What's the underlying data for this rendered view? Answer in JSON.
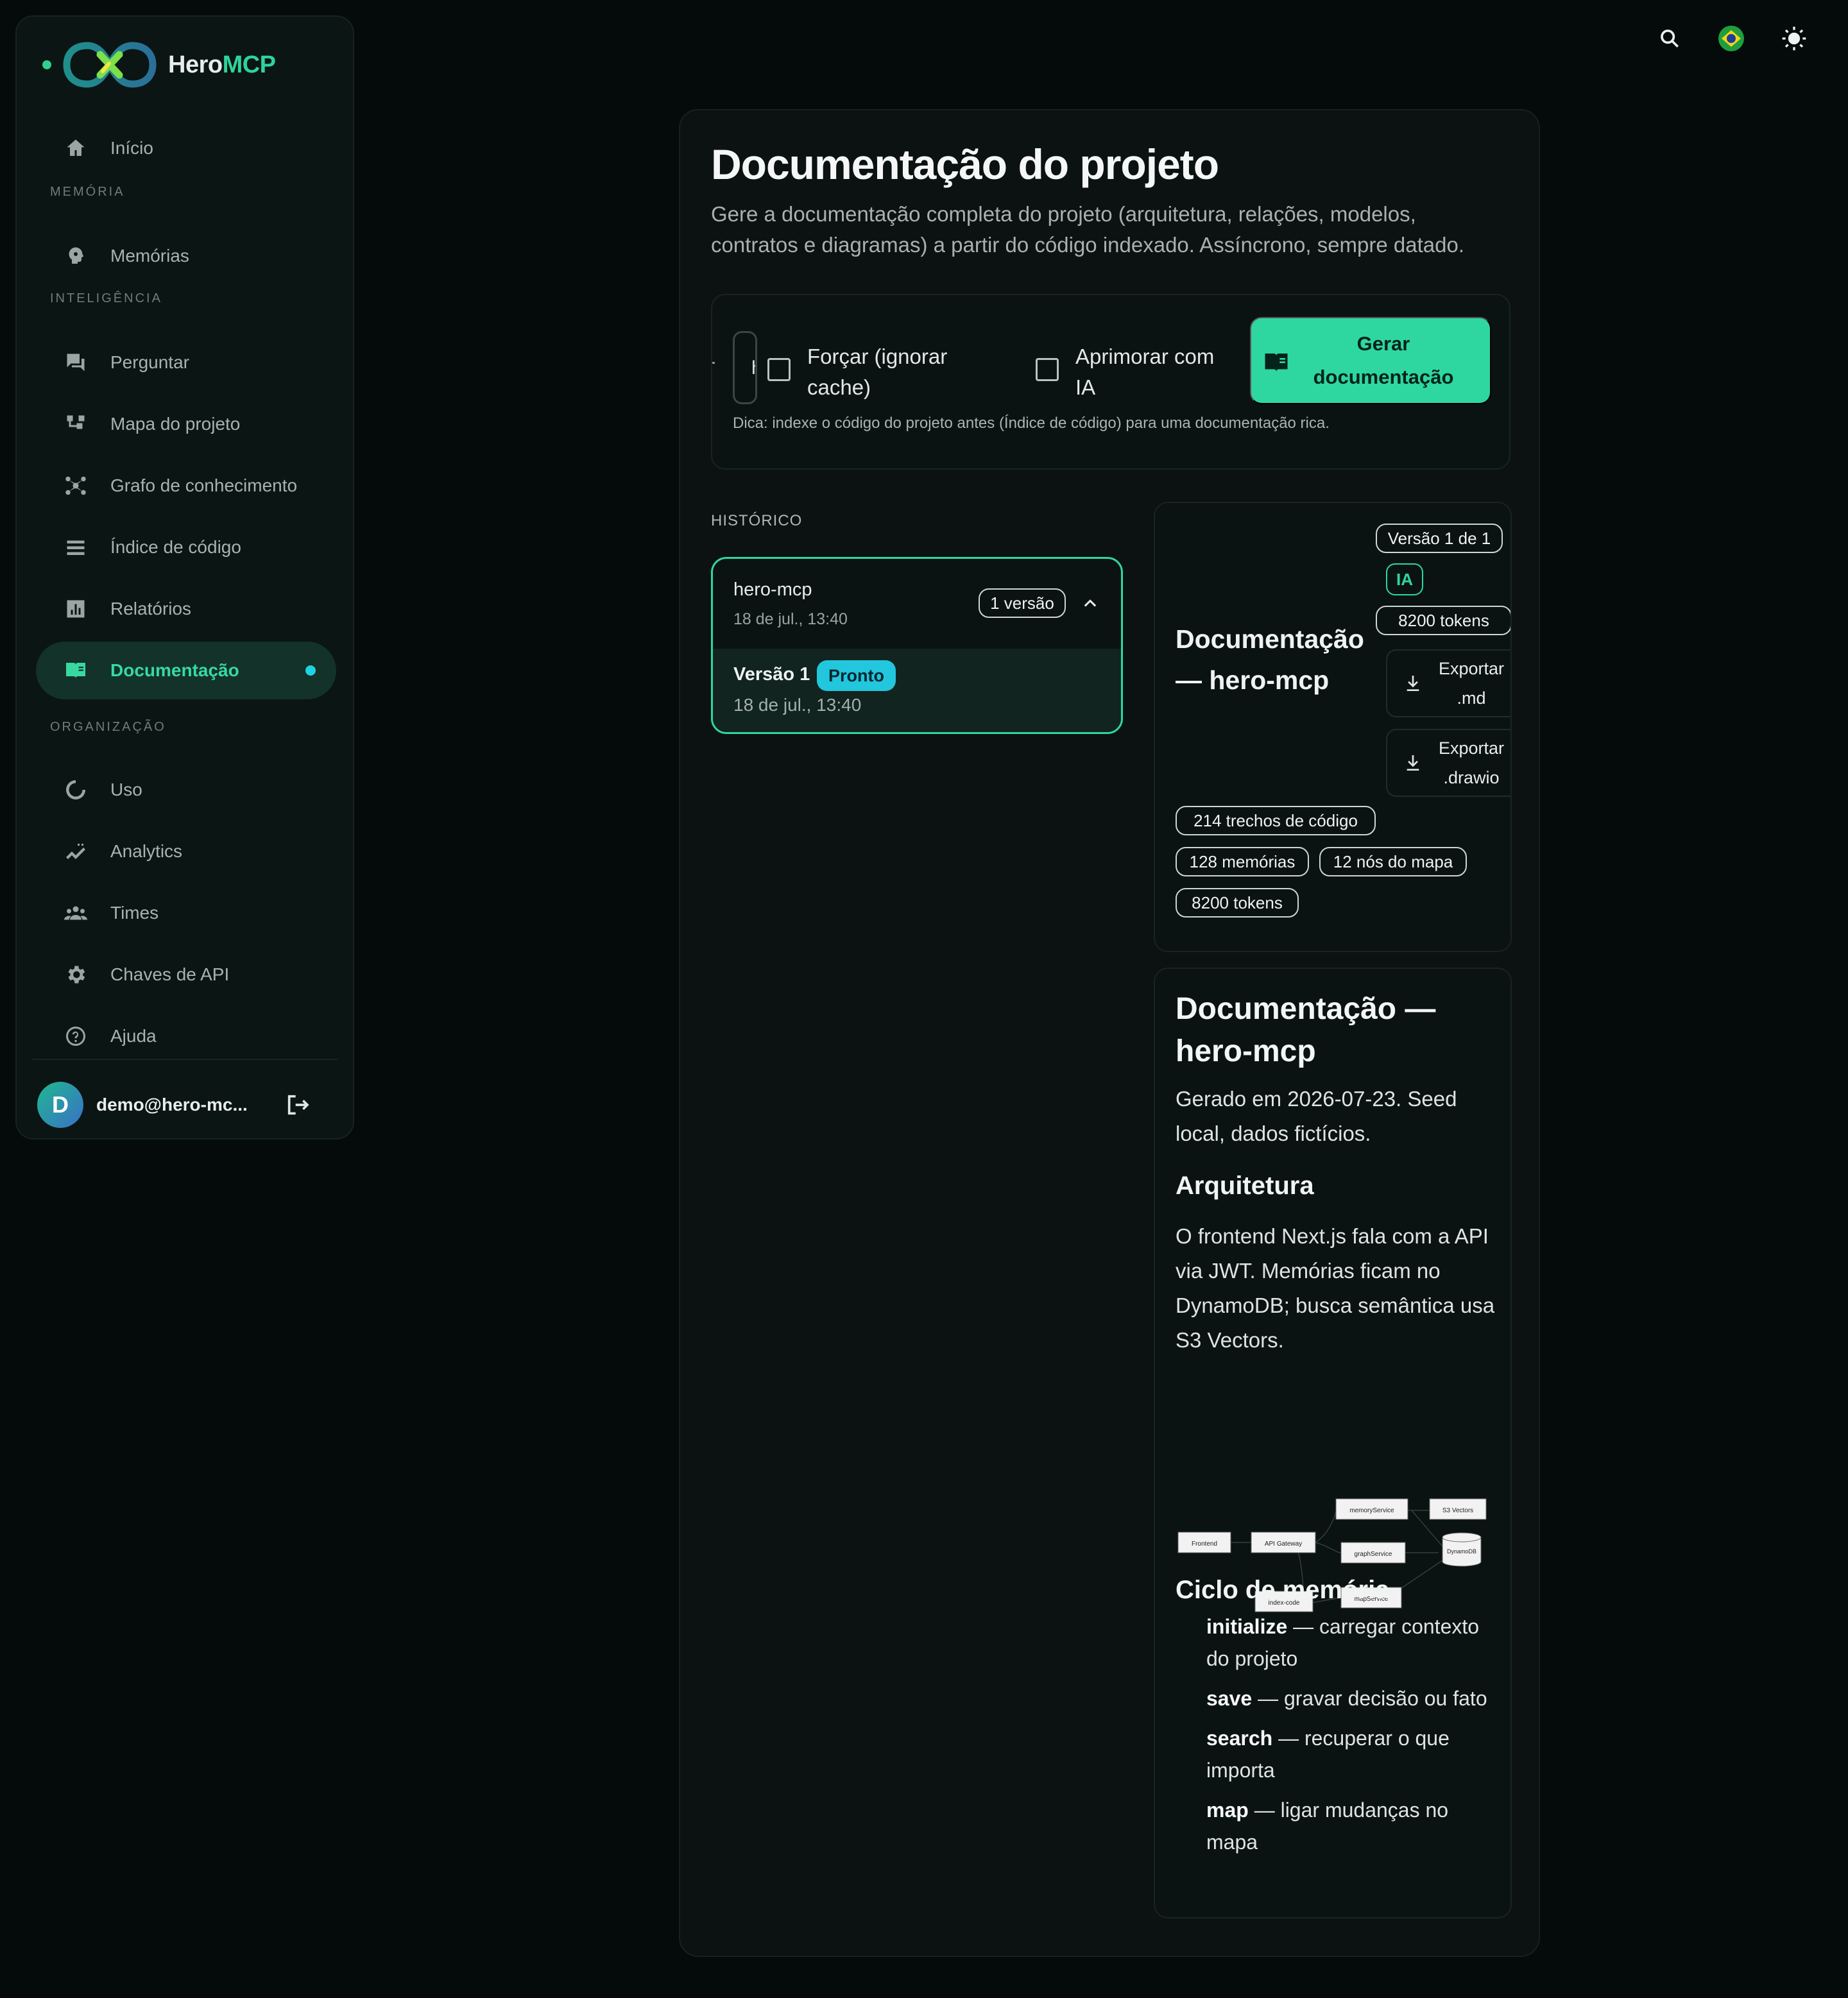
{
  "brand": {
    "name_part1": "Hero",
    "name_part2": "MCP"
  },
  "sidebar": {
    "home": "Início",
    "sections": {
      "memory": "MEMÓRIA",
      "intelligence": "INTELIGÊNCIA",
      "organization": "ORGANIZAÇÃO"
    },
    "items": {
      "memorias": "Memórias",
      "perguntar": "Perguntar",
      "mapa": "Mapa do projeto",
      "grafo": "Grafo de conhecimento",
      "indice": "Índice de código",
      "relatorios": "Relatórios",
      "documentacao": "Documentação",
      "uso": "Uso",
      "analytics": "Analytics",
      "times": "Times",
      "chaves": "Chaves de API",
      "ajuda": "Ajuda"
    },
    "user": {
      "initial": "D",
      "email": "demo@hero-mc..."
    }
  },
  "page": {
    "title": "Documentação do projeto",
    "subtitle": "Gere a documentação completa do projeto (arquitetura, relações, modelos, contratos e diagramas) a partir do código indexado. Assíncrono, sempre datado."
  },
  "generator": {
    "project_value": "hero-mcp",
    "force_label": "Forçar (ignorar cache)",
    "ai_label": "Aprimorar com IA",
    "button_label": "Gerar documentação",
    "hint": "Dica: indexe o código do projeto antes (Índice de código) para uma documentação rica."
  },
  "history": {
    "label": "HISTÓRICO",
    "project": "hero-mcp",
    "date": "18 de jul., 13:40",
    "versions_badge": "1 versão",
    "version": {
      "title": "Versão 1",
      "status": "Pronto",
      "date": "18 de jul., 13:40"
    }
  },
  "info": {
    "version_badge": "Versão 1 de 1",
    "ai_badge": "IA",
    "tokens_badge": "8200 tokens",
    "title": "Documentação — hero-mcp",
    "export_md": "Exportar .md",
    "export_drawio": "Exportar .drawio",
    "stats": [
      "214 trechos de código",
      "128 memórias",
      "12 nós do mapa",
      "8200 tokens"
    ]
  },
  "doc": {
    "title": "Documentação — hero-mcp",
    "intro": "Gerado em 2026-07-23. Seed local, dados fictícios.",
    "arch_title": "Arquitetura",
    "arch_text": "O frontend Next.js fala com a API via JWT. Memórias ficam no DynamoDB; busca semântica usa S3 Vectors.",
    "diagram_nodes": [
      "Frontend",
      "API Gateway",
      "memoryService",
      "S3 Vectors",
      "graphService",
      "DynamoDB",
      "mapService",
      "index-code"
    ],
    "cycle_title": "Ciclo de memória",
    "cycle": [
      {
        "term": "initialize",
        "desc": " — carregar contexto do projeto"
      },
      {
        "term": "save",
        "desc": " — gravar decisão ou fato"
      },
      {
        "term": "search",
        "desc": " — recuperar o que importa"
      },
      {
        "term": "map",
        "desc": " — ligar mudanças no mapa"
      }
    ]
  },
  "colors": {
    "accent": "#2fd7a0",
    "ready_badge": "#22c6dd",
    "background": "#050a0a"
  },
  "icons": [
    "search-icon",
    "brazil-flag-icon",
    "sun-icon",
    "home-icon",
    "brain-icon",
    "chat-icon",
    "map-icon",
    "graph-icon",
    "list-icon",
    "chart-icon",
    "book-icon",
    "usage-icon",
    "analytics-icon",
    "team-icon",
    "gear-icon",
    "help-icon",
    "logout-icon",
    "download-icon",
    "chevron-up-icon"
  ]
}
